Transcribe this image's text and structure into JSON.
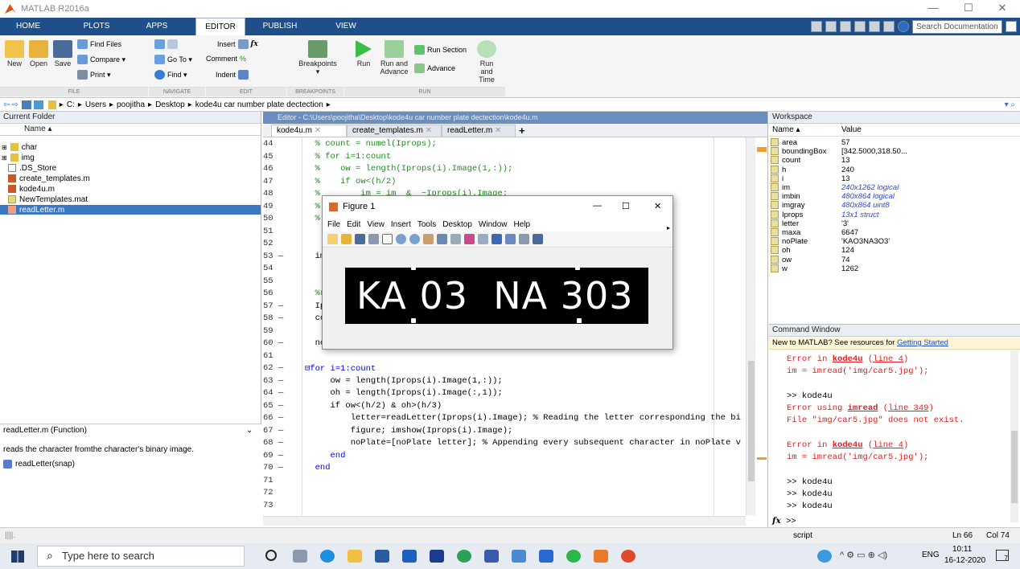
{
  "window": {
    "title": "MATLAB R2016a",
    "min": "—",
    "max": "☐",
    "close": "✕"
  },
  "ribbon_tabs": [
    "HOME",
    "PLOTS",
    "APPS",
    "EDITOR",
    "PUBLISH",
    "VIEW"
  ],
  "search_doc_placeholder": "Search Documentation",
  "ribbon": {
    "new": "New",
    "open": "Open",
    "save": "Save",
    "find_files": "Find Files",
    "compare": "Compare ▾",
    "print": "Print ▾",
    "go_to": "Go To ▾",
    "comment": "Comment",
    "find": "Find ▾",
    "insert": "Insert",
    "indent": "Indent",
    "breakpoints": "Breakpoints",
    "run": "Run",
    "run_and_advance": "Run and Advance",
    "run_section": "Run Section",
    "advance": "Advance",
    "run_and_time": "Run and Time",
    "sections": [
      "FILE",
      "NAVIGATE",
      "EDIT",
      "BREAKPOINTS",
      "RUN"
    ]
  },
  "breadcrumbs": [
    "C:",
    "Users",
    "poojitha",
    "Desktop",
    "kode4u car number plate dectection"
  ],
  "current_folder": {
    "title": "Current Folder",
    "column": "Name ▴",
    "items": [
      "char",
      "img",
      ".DS_Store",
      "create_templates.m",
      "kode4u.m",
      "NewTemplates.mat",
      "readLetter.m"
    ],
    "details_title": "readLetter.m  (Function)",
    "details_desc": "reads the character fromthe character's binary image.",
    "details_func": "readLetter(snap)"
  },
  "editor": {
    "title": "Editor - C:\\Users\\poojitha\\Desktop\\kode4u car number plate dectection\\kode4u.m",
    "tabs": [
      "kode4u.m",
      "create_templates.m",
      "readLetter.m"
    ],
    "lines": [
      {
        "n": "44",
        "t": "  % count = numel(Iprops);",
        "c": "cmt"
      },
      {
        "n": "45",
        "t": "  % for i=1:count",
        "c": "cmt"
      },
      {
        "n": "46",
        "t": "  %    ow = length(Iprops(i).Image(1,:));",
        "c": "cmt"
      },
      {
        "n": "47",
        "t": "  %    if ow<(h/2)",
        "c": "cmt"
      },
      {
        "n": "48",
        "t": "  %        im = im  &  ~Iprops(i).Image;",
        "c": "cmt"
      },
      {
        "n": "49",
        "t": "  %",
        "c": "cmt"
      },
      {
        "n": "50",
        "t": "  % en",
        "c": "cmt"
      },
      {
        "n": "51",
        "t": "",
        "c": ""
      },
      {
        "n": "52",
        "t": "",
        "c": ""
      },
      {
        "n": "53 —",
        "t": "  imsh",
        "c": ""
      },
      {
        "n": "54",
        "t": "",
        "c": ""
      },
      {
        "n": "55",
        "t": "",
        "c": ""
      },
      {
        "n": "56",
        "t": "  %rea",
        "c": "cmt"
      },
      {
        "n": "57 —",
        "t": "  Ipro",
        "c": ""
      },
      {
        "n": "58 —",
        "t": "  coun",
        "c": ""
      },
      {
        "n": "59",
        "t": "",
        "c": ""
      },
      {
        "n": "60 —",
        "t": "  noPl",
        "c": ""
      },
      {
        "n": "61",
        "t": "",
        "c": ""
      },
      {
        "n": "62 —",
        "t": "⊟for i=1:count",
        "c": "kw"
      },
      {
        "n": "63 —",
        "t": "     ow = length(Iprops(i).Image(1,:));",
        "c": ""
      },
      {
        "n": "64 —",
        "t": "     oh = length(Iprops(i).Image(:,1));",
        "c": ""
      },
      {
        "n": "65 —",
        "t": "     if ow<(h/2) & oh>(h/3)",
        "c": ""
      },
      {
        "n": "66 —",
        "t": "         letter=readLetter(Iprops(i).Image); % Reading the letter corresponding the bi",
        "c": ""
      },
      {
        "n": "67 —",
        "t": "         figure; imshow(Iprops(i).Image);",
        "c": ""
      },
      {
        "n": "68 —",
        "t": "         noPlate=[noPlate letter]; % Appending every subsequent character in noPlate v",
        "c": ""
      },
      {
        "n": "69 —",
        "t": "     end",
        "c": "kw"
      },
      {
        "n": "70 —",
        "t": "  end",
        "c": "kw"
      },
      {
        "n": "71",
        "t": "",
        "c": ""
      },
      {
        "n": "72",
        "t": "",
        "c": ""
      },
      {
        "n": "73",
        "t": "",
        "c": ""
      }
    ]
  },
  "figure": {
    "title": "Figure 1",
    "menu": [
      "File",
      "Edit",
      "View",
      "Insert",
      "Tools",
      "Desktop",
      "Window",
      "Help"
    ],
    "plate_text": "KA 03  NA 303"
  },
  "workspace": {
    "title": "Workspace",
    "col_name": "Name ▴",
    "col_value": "Value",
    "vars": [
      {
        "name": "area",
        "value": "57",
        "italic": false
      },
      {
        "name": "boundingBox",
        "value": "[342.5000,318.50...",
        "italic": false
      },
      {
        "name": "count",
        "value": "13",
        "italic": false
      },
      {
        "name": "h",
        "value": "240",
        "italic": false
      },
      {
        "name": "i",
        "value": "13",
        "italic": false
      },
      {
        "name": "im",
        "value": "240x1262 logical",
        "italic": true
      },
      {
        "name": "imbin",
        "value": "480x864 logical",
        "italic": true
      },
      {
        "name": "imgray",
        "value": "480x864 uint8",
        "italic": true
      },
      {
        "name": "Iprops",
        "value": "13x1 struct",
        "italic": true
      },
      {
        "name": "letter",
        "value": "'3'",
        "italic": false
      },
      {
        "name": "maxa",
        "value": "6647",
        "italic": false
      },
      {
        "name": "noPlate",
        "value": "'KAO3NA3O3'",
        "italic": false
      },
      {
        "name": "oh",
        "value": "124",
        "italic": false
      },
      {
        "name": "ow",
        "value": "74",
        "italic": false
      },
      {
        "name": "w",
        "value": "1262",
        "italic": false
      }
    ]
  },
  "command_window": {
    "title": "Command Window",
    "info_prefix": "New to MATLAB? See resources for ",
    "info_link": "Getting Started",
    "prompt": ">>"
  },
  "status_bar": {
    "mode": "script",
    "ln": "Ln 66",
    "col": "Col 74"
  },
  "taskbar": {
    "search_placeholder": "Type here to search",
    "lang": "ENG",
    "time": "10:11",
    "date": "16-12-2020",
    "notif_count": "7"
  }
}
